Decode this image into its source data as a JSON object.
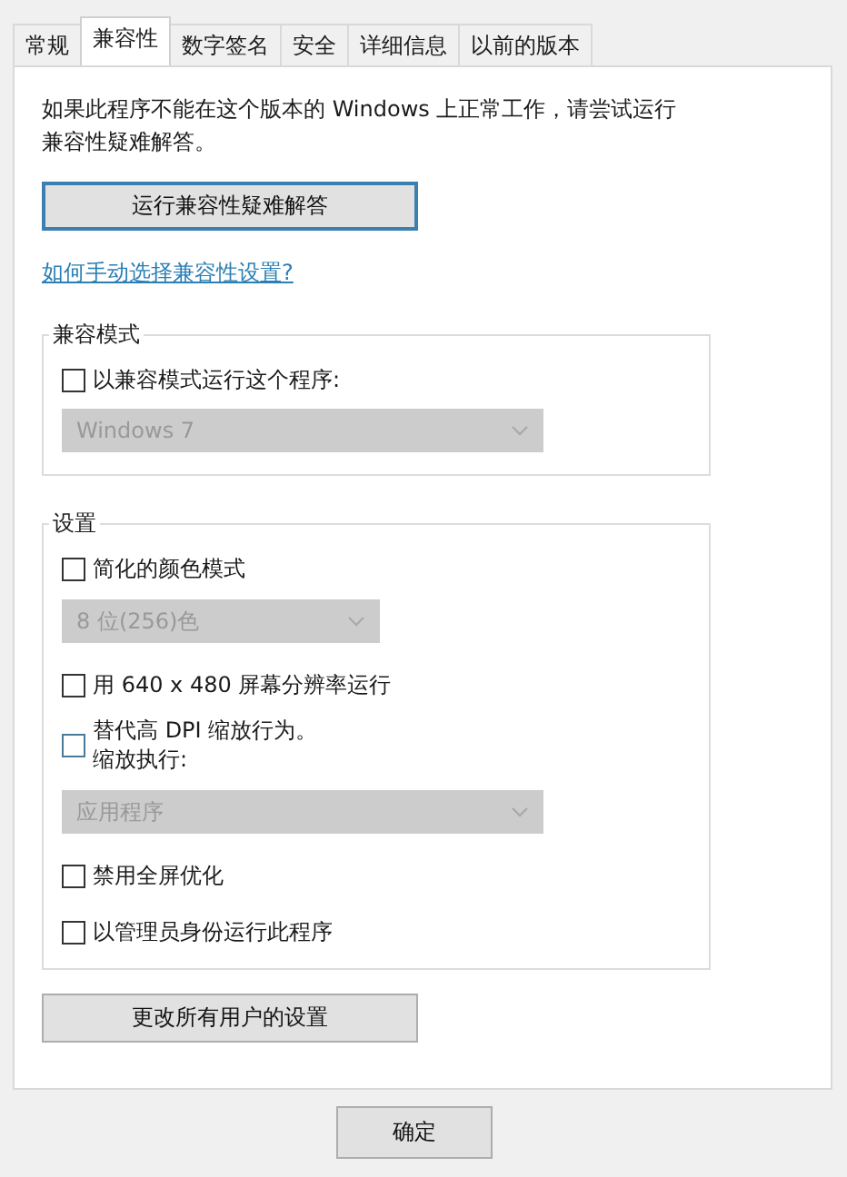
{
  "tabs": [
    {
      "label": "常规",
      "selected": false
    },
    {
      "label": "兼容性",
      "selected": true
    },
    {
      "label": "数字签名",
      "selected": false
    },
    {
      "label": "安全",
      "selected": false
    },
    {
      "label": "详细信息",
      "selected": false
    },
    {
      "label": "以前的版本",
      "selected": false
    }
  ],
  "intro": "如果此程序不能在这个版本的 Windows 上正常工作，请尝试运行兼容性疑难解答。",
  "troubleshoot_button": "运行兼容性疑难解答",
  "help_link": "如何手动选择兼容性设置?",
  "groups": [
    {
      "title": "兼容模式",
      "items": [
        {
          "kind": "checkbox",
          "label": "以兼容模式运行这个程序:",
          "checked": false
        },
        {
          "kind": "dropdown",
          "value": "Windows 7",
          "disabled": true
        }
      ]
    },
    {
      "title": "设置",
      "items": [
        {
          "kind": "checkbox",
          "label": "简化的颜色模式",
          "checked": false
        },
        {
          "kind": "dropdown",
          "value": "8 位(256)色",
          "disabled": true,
          "narrow": true
        },
        {
          "kind": "checkbox",
          "label": "用 640 x 480 屏幕分辨率运行",
          "checked": false
        },
        {
          "kind": "checkbox",
          "label": "替代高 DPI 缩放行为。",
          "sublabel": "缩放执行:",
          "checked": false
        },
        {
          "kind": "dropdown",
          "value": "应用程序",
          "disabled": true
        },
        {
          "kind": "checkbox",
          "label": "禁用全屏优化",
          "checked": false
        },
        {
          "kind": "checkbox",
          "label": "以管理员身份运行此程序",
          "checked": false
        }
      ]
    }
  ],
  "all_users_button": "更改所有用户的设置",
  "footer_buttons": [
    "确定"
  ]
}
